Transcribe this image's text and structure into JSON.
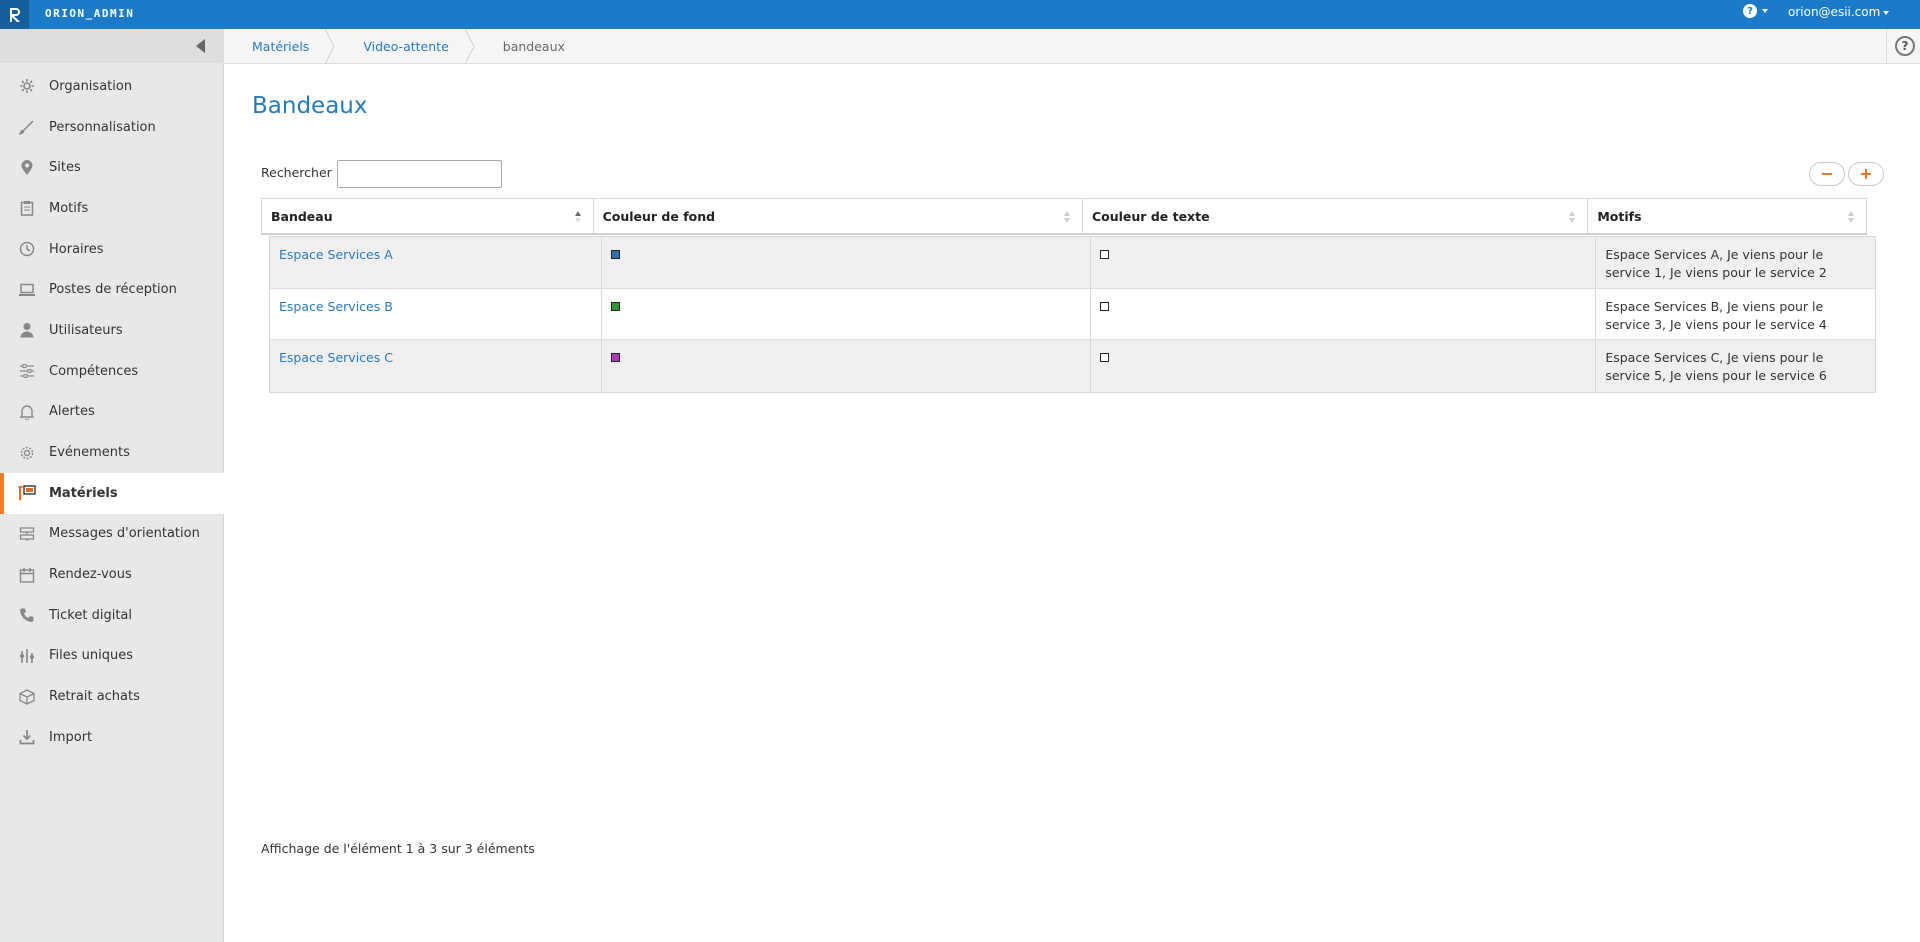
{
  "topbar": {
    "app_title": "ORION_ADMIN",
    "user": "orion@esii.com",
    "brand_color": "#1b7bc8"
  },
  "sidebar": {
    "items": [
      {
        "label": "Organisation",
        "icon": "gear-icon"
      },
      {
        "label": "Personnalisation",
        "icon": "brush-icon"
      },
      {
        "label": "Sites",
        "icon": "map-pin-icon"
      },
      {
        "label": "Motifs",
        "icon": "clipboard-icon"
      },
      {
        "label": "Horaires",
        "icon": "clock-icon"
      },
      {
        "label": "Postes de réception",
        "icon": "laptop-icon"
      },
      {
        "label": "Utilisateurs",
        "icon": "user-icon"
      },
      {
        "label": "Compétences",
        "icon": "sliders-icon"
      },
      {
        "label": "Alertes",
        "icon": "bell-icon"
      },
      {
        "label": "Evénements",
        "icon": "cogs-icon"
      },
      {
        "label": "Matériels",
        "icon": "hardware-icon",
        "active": true
      },
      {
        "label": "Messages d'orientation",
        "icon": "signpost-icon"
      },
      {
        "label": "Rendez-vous",
        "icon": "calendar-icon"
      },
      {
        "label": "Ticket digital",
        "icon": "phone-icon"
      },
      {
        "label": "Files uniques",
        "icon": "queue-icon"
      },
      {
        "label": "Retrait achats",
        "icon": "box-icon"
      },
      {
        "label": "Import",
        "icon": "download-icon"
      }
    ]
  },
  "breadcrumb": [
    "Matériels",
    "Video-attente",
    "bandeaux"
  ],
  "main": {
    "title": "Bandeaux",
    "search_label": "Rechercher :",
    "search_value": "",
    "remove_button": "−",
    "add_button": "+"
  },
  "table": {
    "columns": [
      "Bandeau",
      "Couleur de fond",
      "Couleur de texte",
      "Motifs"
    ],
    "rows": [
      {
        "bandeau": "Espace Services A",
        "couleur_fond": "#2f6fb0",
        "couleur_texte": "#ffffff",
        "motifs": "Espace Services A, Je viens pour le service 1, Je viens pour le service 2"
      },
      {
        "bandeau": "Espace Services B",
        "couleur_fond": "#2e9a35",
        "couleur_texte": "#ffffff",
        "motifs": "Espace Services B, Je viens pour le service 3, Je viens pour le service 4"
      },
      {
        "bandeau": "Espace Services C",
        "couleur_fond": "#b033b8",
        "couleur_texte": "#ffffff",
        "motifs": "Espace Services C, Je viens pour le service 5, Je viens pour le service 6"
      }
    ]
  },
  "footer": {
    "info": "Affichage de l'élément 1 à 3 sur 3 éléments"
  }
}
